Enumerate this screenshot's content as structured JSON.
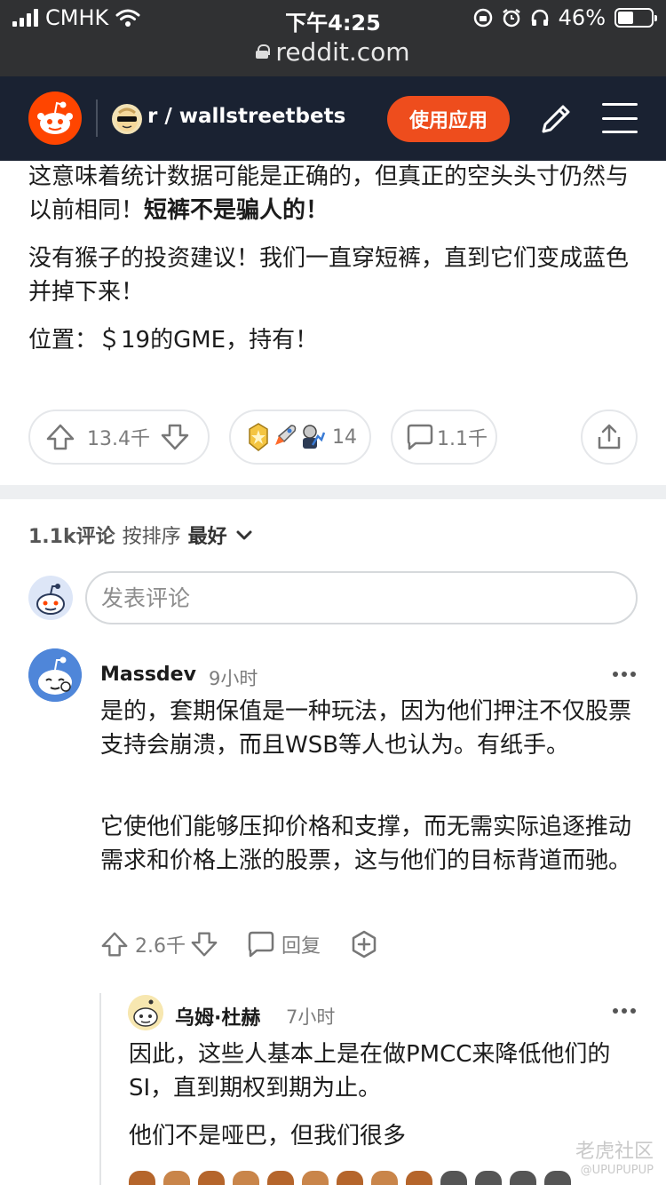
{
  "status_bar": {
    "carrier": "CMHK",
    "time": "下午4:25",
    "battery": "46%",
    "battery_level": 0.46
  },
  "browser": {
    "url": "reddit.com"
  },
  "header": {
    "subreddit": "r / wallstreetbets",
    "use_app_label": "使用应用"
  },
  "post": {
    "paragraph1_a": "这意味着统计数据可能是正确的，但真正的空头头寸仍然与以前相同！",
    "paragraph1_bold": "短裤不是骗人的！",
    "paragraph2": "没有猴子的投资建议！我们一直穿短裤，直到它们变成蓝色并掉下来！",
    "paragraph3": "位置：＄19的GME，持有！",
    "votes": "13.4千",
    "awards_count": "14",
    "comments_count": "1.1千"
  },
  "comments_header": {
    "count_label": "1.1k评论",
    "sort_prefix": "按排序",
    "sort_value": "最好"
  },
  "comment_input": {
    "placeholder": "发表评论"
  },
  "comments": [
    {
      "author": "Massdev",
      "time": "9小时",
      "body1": "是的，套期保值是一种玩法，因为他们押注不仅股票支持会崩溃，而且WSB等人也认为。有纸手。",
      "body2": "它使他们能够压抑价格和支撑，而无需实际追逐推动需求和价格上涨的股票，这与他们的目标背道而驰。",
      "votes": "2.6千",
      "reply_label": "回复"
    },
    {
      "author": "乌姆·杜赫",
      "time": "7小时",
      "body1": "因此，这些人基本上是在做PMCC来降低他们的SI，直到期权到期为止。",
      "body2": "他们不是哑巴，但我们很多"
    }
  ],
  "watermark": {
    "main": "老虎社区",
    "sub": "@UPUPUPUP"
  },
  "colors": {
    "reddit_orange": "#ff4500",
    "header_bg": "#1a2232",
    "status_bg": "#303133",
    "button_orange": "#ee4d1d"
  }
}
